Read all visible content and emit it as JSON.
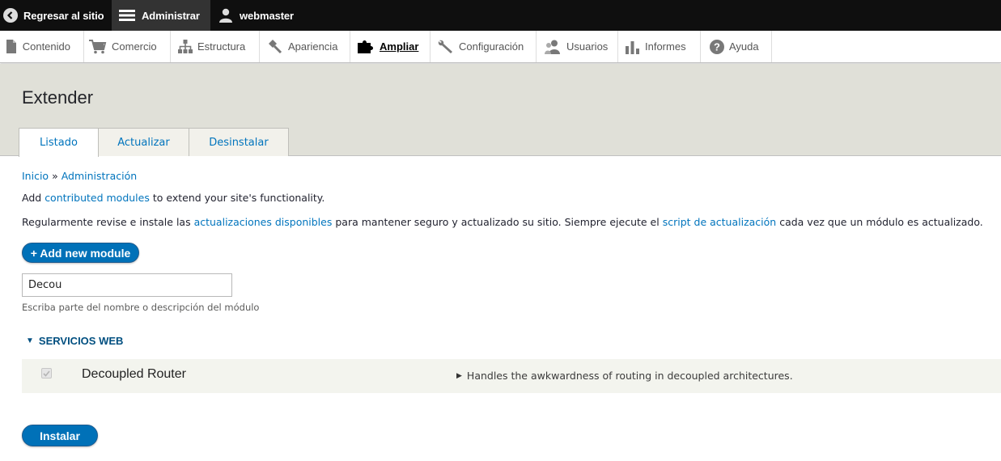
{
  "toolbar": {
    "back_label": "Regresar al sitio",
    "admin_label": "Administrar",
    "user_label": "webmaster"
  },
  "tray": {
    "items": [
      {
        "label": "Contenido",
        "icon": "file-icon"
      },
      {
        "label": "Comercio",
        "icon": "cart-icon"
      },
      {
        "label": "Estructura",
        "icon": "sitemap-icon"
      },
      {
        "label": "Apariencia",
        "icon": "brush-icon"
      },
      {
        "label": "Ampliar",
        "icon": "puzzle-icon",
        "active": true
      },
      {
        "label": "Configuración",
        "icon": "wrench-icon"
      },
      {
        "label": "Usuarios",
        "icon": "people-icon"
      },
      {
        "label": "Informes",
        "icon": "bar-chart-icon"
      },
      {
        "label": "Ayuda",
        "icon": "help-icon"
      }
    ]
  },
  "page": {
    "title": "Extender",
    "tabs": [
      "Listado",
      "Actualizar",
      "Desinstalar"
    ],
    "active_tab": "Listado"
  },
  "breadcrumb": {
    "home": "Inicio",
    "separator": "»",
    "admin": "Administración"
  },
  "intro": {
    "p1_before": "Add",
    "p1_link": "contributed modules",
    "p1_after": "to extend your site's functionality.",
    "p2_before": "Regularmente revise e instale las",
    "p2_link1": "actualizaciones disponibles",
    "p2_middle": "para mantener seguro y actualizado su sitio. Siempre ejecute el",
    "p2_link2": "script de actualización",
    "p2_after": "cada vez que un módulo es actualizado."
  },
  "add_module_button": "+ Add new module",
  "filter": {
    "value": "Decou",
    "description": "Escriba parte del nombre o descripción del módulo"
  },
  "section": {
    "title": "SERVICIOS WEB"
  },
  "modules": [
    {
      "name": "Decoupled Router",
      "description": "Handles the awkwardness of routing in decoupled architectures.",
      "checked": true,
      "disabled": true
    }
  ],
  "install_button": "Instalar",
  "colors": {
    "accent": "#0074bd",
    "button_blue": "#0071b8",
    "toolbar_bg": "#0f0f0f",
    "header_bg": "#e0e0d8",
    "section_title": "#004f80"
  }
}
